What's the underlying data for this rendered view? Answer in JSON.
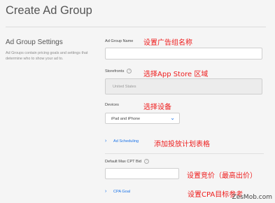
{
  "page": {
    "title": "Create Ad Group"
  },
  "section": {
    "title": "Ad Group Settings",
    "description": "Ad Groups contain pricing goals and settings that determine who to show your ad to."
  },
  "fields": {
    "ad_group_name": {
      "label": "Ad Group Name",
      "value": ""
    },
    "storefronts": {
      "label": "Storefronts",
      "value": "United States",
      "help_icon": "question-icon"
    },
    "devices": {
      "label": "Devices",
      "value": "iPad and iPhone"
    },
    "ad_scheduling": {
      "label": "Ad Scheduling",
      "icon": "chevron-right-icon"
    },
    "default_max_cpt_bid": {
      "label": "Default Max CPT Bid",
      "value": "",
      "help_icon": "question-icon"
    },
    "cpa_goal": {
      "label": "CPA Goal",
      "icon": "chevron-right-icon"
    }
  },
  "annotations": {
    "name": "设置广告组名称",
    "storefronts": "选择App Store 区域",
    "devices": "选择设备",
    "scheduling": "添加投放计划表格",
    "bid": "设置竞价（最高出价）",
    "cpa": "设置CPA目标参考"
  },
  "watermark": "ZesMob.com",
  "colors": {
    "accent": "#1a73e8",
    "annotation": "#ee1c1c",
    "background": "#f5f5f5"
  }
}
